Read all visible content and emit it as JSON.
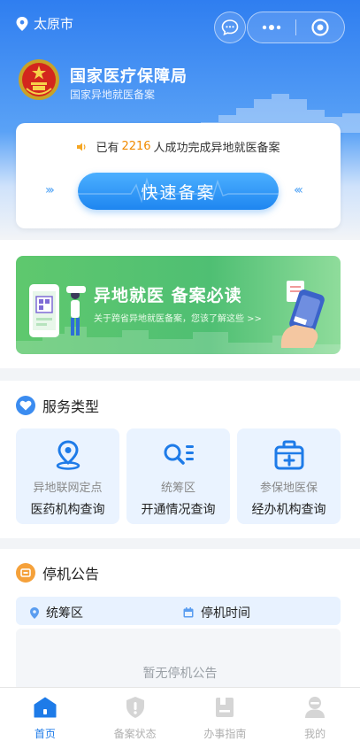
{
  "header": {
    "location": "太原市",
    "org_title": "国家医疗保障局",
    "org_subtitle": "国家异地就医备案"
  },
  "quick_filing": {
    "notice_prefix": "已有",
    "count": "2216",
    "notice_suffix": "人成功完成异地就医备案",
    "button_label": "快速备案"
  },
  "banner": {
    "title": "异地就医 备案必读",
    "subtitle": "关于跨省异地就医备案，您该了解这些 >>"
  },
  "services": {
    "title": "服务类型",
    "items": [
      {
        "line1": "异地联网定点",
        "line2": "医药机构查询",
        "icon": "location-pin-icon"
      },
      {
        "line1": "统筹区",
        "line2": "开通情况查询",
        "icon": "search-list-icon"
      },
      {
        "line1": "参保地医保",
        "line2": "经办机构查询",
        "icon": "medical-kit-icon"
      }
    ]
  },
  "outage": {
    "title": "停机公告",
    "col_region": "统筹区",
    "col_time": "停机时间",
    "empty_text": "暂无停机公告"
  },
  "tabbar": {
    "items": [
      {
        "label": "首页",
        "icon": "home-icon",
        "active": true
      },
      {
        "label": "备案状态",
        "icon": "shield-status-icon",
        "active": false
      },
      {
        "label": "办事指南",
        "icon": "guide-book-icon",
        "active": false
      },
      {
        "label": "我的",
        "icon": "user-icon",
        "active": false
      }
    ]
  },
  "colors": {
    "primary": "#1e7be8",
    "accent_orange": "#f08a00",
    "banner_green": "#4fbf73"
  }
}
